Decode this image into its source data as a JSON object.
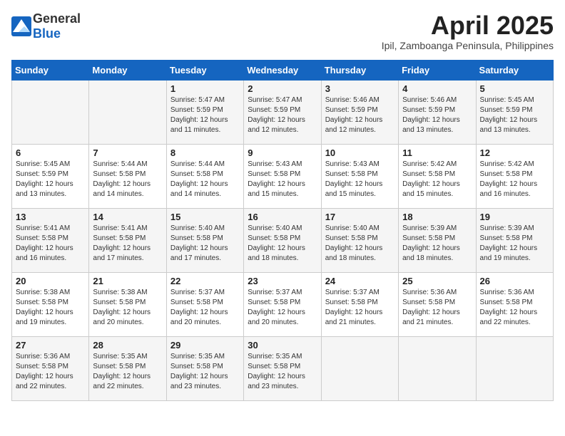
{
  "header": {
    "logo_general": "General",
    "logo_blue": "Blue",
    "month_title": "April 2025",
    "subtitle": "Ipil, Zamboanga Peninsula, Philippines"
  },
  "days_of_week": [
    "Sunday",
    "Monday",
    "Tuesday",
    "Wednesday",
    "Thursday",
    "Friday",
    "Saturday"
  ],
  "weeks": [
    [
      {
        "day": "",
        "info": ""
      },
      {
        "day": "",
        "info": ""
      },
      {
        "day": "1",
        "info": "Sunrise: 5:47 AM\nSunset: 5:59 PM\nDaylight: 12 hours and 11 minutes."
      },
      {
        "day": "2",
        "info": "Sunrise: 5:47 AM\nSunset: 5:59 PM\nDaylight: 12 hours and 12 minutes."
      },
      {
        "day": "3",
        "info": "Sunrise: 5:46 AM\nSunset: 5:59 PM\nDaylight: 12 hours and 12 minutes."
      },
      {
        "day": "4",
        "info": "Sunrise: 5:46 AM\nSunset: 5:59 PM\nDaylight: 12 hours and 13 minutes."
      },
      {
        "day": "5",
        "info": "Sunrise: 5:45 AM\nSunset: 5:59 PM\nDaylight: 12 hours and 13 minutes."
      }
    ],
    [
      {
        "day": "6",
        "info": "Sunrise: 5:45 AM\nSunset: 5:59 PM\nDaylight: 12 hours and 13 minutes."
      },
      {
        "day": "7",
        "info": "Sunrise: 5:44 AM\nSunset: 5:58 PM\nDaylight: 12 hours and 14 minutes."
      },
      {
        "day": "8",
        "info": "Sunrise: 5:44 AM\nSunset: 5:58 PM\nDaylight: 12 hours and 14 minutes."
      },
      {
        "day": "9",
        "info": "Sunrise: 5:43 AM\nSunset: 5:58 PM\nDaylight: 12 hours and 15 minutes."
      },
      {
        "day": "10",
        "info": "Sunrise: 5:43 AM\nSunset: 5:58 PM\nDaylight: 12 hours and 15 minutes."
      },
      {
        "day": "11",
        "info": "Sunrise: 5:42 AM\nSunset: 5:58 PM\nDaylight: 12 hours and 15 minutes."
      },
      {
        "day": "12",
        "info": "Sunrise: 5:42 AM\nSunset: 5:58 PM\nDaylight: 12 hours and 16 minutes."
      }
    ],
    [
      {
        "day": "13",
        "info": "Sunrise: 5:41 AM\nSunset: 5:58 PM\nDaylight: 12 hours and 16 minutes."
      },
      {
        "day": "14",
        "info": "Sunrise: 5:41 AM\nSunset: 5:58 PM\nDaylight: 12 hours and 17 minutes."
      },
      {
        "day": "15",
        "info": "Sunrise: 5:40 AM\nSunset: 5:58 PM\nDaylight: 12 hours and 17 minutes."
      },
      {
        "day": "16",
        "info": "Sunrise: 5:40 AM\nSunset: 5:58 PM\nDaylight: 12 hours and 18 minutes."
      },
      {
        "day": "17",
        "info": "Sunrise: 5:40 AM\nSunset: 5:58 PM\nDaylight: 12 hours and 18 minutes."
      },
      {
        "day": "18",
        "info": "Sunrise: 5:39 AM\nSunset: 5:58 PM\nDaylight: 12 hours and 18 minutes."
      },
      {
        "day": "19",
        "info": "Sunrise: 5:39 AM\nSunset: 5:58 PM\nDaylight: 12 hours and 19 minutes."
      }
    ],
    [
      {
        "day": "20",
        "info": "Sunrise: 5:38 AM\nSunset: 5:58 PM\nDaylight: 12 hours and 19 minutes."
      },
      {
        "day": "21",
        "info": "Sunrise: 5:38 AM\nSunset: 5:58 PM\nDaylight: 12 hours and 20 minutes."
      },
      {
        "day": "22",
        "info": "Sunrise: 5:37 AM\nSunset: 5:58 PM\nDaylight: 12 hours and 20 minutes."
      },
      {
        "day": "23",
        "info": "Sunrise: 5:37 AM\nSunset: 5:58 PM\nDaylight: 12 hours and 20 minutes."
      },
      {
        "day": "24",
        "info": "Sunrise: 5:37 AM\nSunset: 5:58 PM\nDaylight: 12 hours and 21 minutes."
      },
      {
        "day": "25",
        "info": "Sunrise: 5:36 AM\nSunset: 5:58 PM\nDaylight: 12 hours and 21 minutes."
      },
      {
        "day": "26",
        "info": "Sunrise: 5:36 AM\nSunset: 5:58 PM\nDaylight: 12 hours and 22 minutes."
      }
    ],
    [
      {
        "day": "27",
        "info": "Sunrise: 5:36 AM\nSunset: 5:58 PM\nDaylight: 12 hours and 22 minutes."
      },
      {
        "day": "28",
        "info": "Sunrise: 5:35 AM\nSunset: 5:58 PM\nDaylight: 12 hours and 22 minutes."
      },
      {
        "day": "29",
        "info": "Sunrise: 5:35 AM\nSunset: 5:58 PM\nDaylight: 12 hours and 23 minutes."
      },
      {
        "day": "30",
        "info": "Sunrise: 5:35 AM\nSunset: 5:58 PM\nDaylight: 12 hours and 23 minutes."
      },
      {
        "day": "",
        "info": ""
      },
      {
        "day": "",
        "info": ""
      },
      {
        "day": "",
        "info": ""
      }
    ]
  ]
}
